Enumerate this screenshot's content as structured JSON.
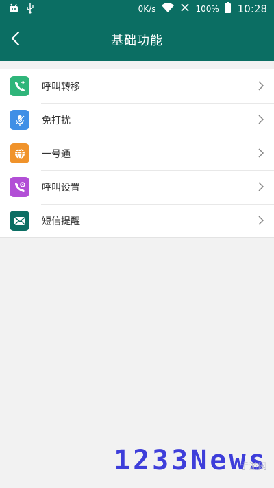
{
  "status_bar": {
    "speed": "0K/s",
    "battery": "100%",
    "time": "10:28"
  },
  "header": {
    "title": "基础功能",
    "back_icon": "chevron-left-icon"
  },
  "menu": {
    "items": [
      {
        "label": "呼叫转移",
        "icon": "call-forward-icon",
        "color": "#2fb57a"
      },
      {
        "label": "免打扰",
        "icon": "mute-mic-icon",
        "color": "#3f8fe6"
      },
      {
        "label": "一号通",
        "icon": "globe-icon",
        "color": "#f0932b"
      },
      {
        "label": "呼叫设置",
        "icon": "call-settings-icon",
        "color": "#b24fd6"
      },
      {
        "label": "短信提醒",
        "icon": "envelope-icon",
        "color": "#0b6e63"
      }
    ]
  },
  "watermark": {
    "main": "1233News",
    "sub": "手游网"
  },
  "colors": {
    "header_bg": "#0b6e63",
    "page_bg": "#f2f2f2"
  }
}
